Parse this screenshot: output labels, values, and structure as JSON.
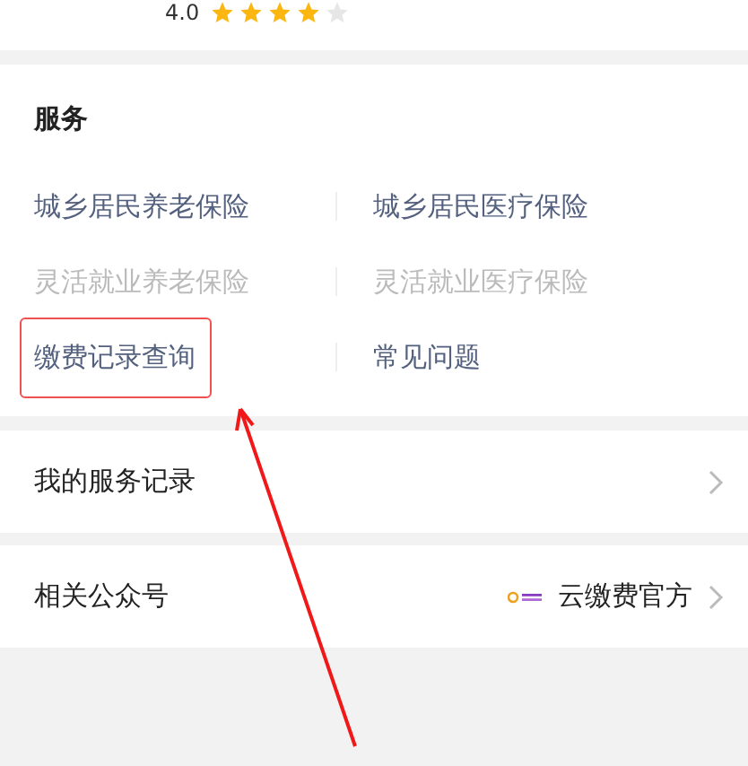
{
  "rating": {
    "score": "4.0",
    "stars": 4
  },
  "services": {
    "title": "服务",
    "items": [
      {
        "label": "城乡居民养老保险",
        "disabled": false,
        "highlighted": false
      },
      {
        "label": "城乡居民医疗保险",
        "disabled": false,
        "highlighted": false
      },
      {
        "label": "灵活就业养老保险",
        "disabled": true,
        "highlighted": false
      },
      {
        "label": "灵活就业医疗保险",
        "disabled": true,
        "highlighted": false
      },
      {
        "label": "缴费记录查询",
        "disabled": false,
        "highlighted": true
      },
      {
        "label": "常见问题",
        "disabled": false,
        "highlighted": false
      }
    ]
  },
  "rows": [
    {
      "label": "我的服务记录"
    },
    {
      "label": "相关公众号",
      "value": "云缴费官方"
    }
  ]
}
